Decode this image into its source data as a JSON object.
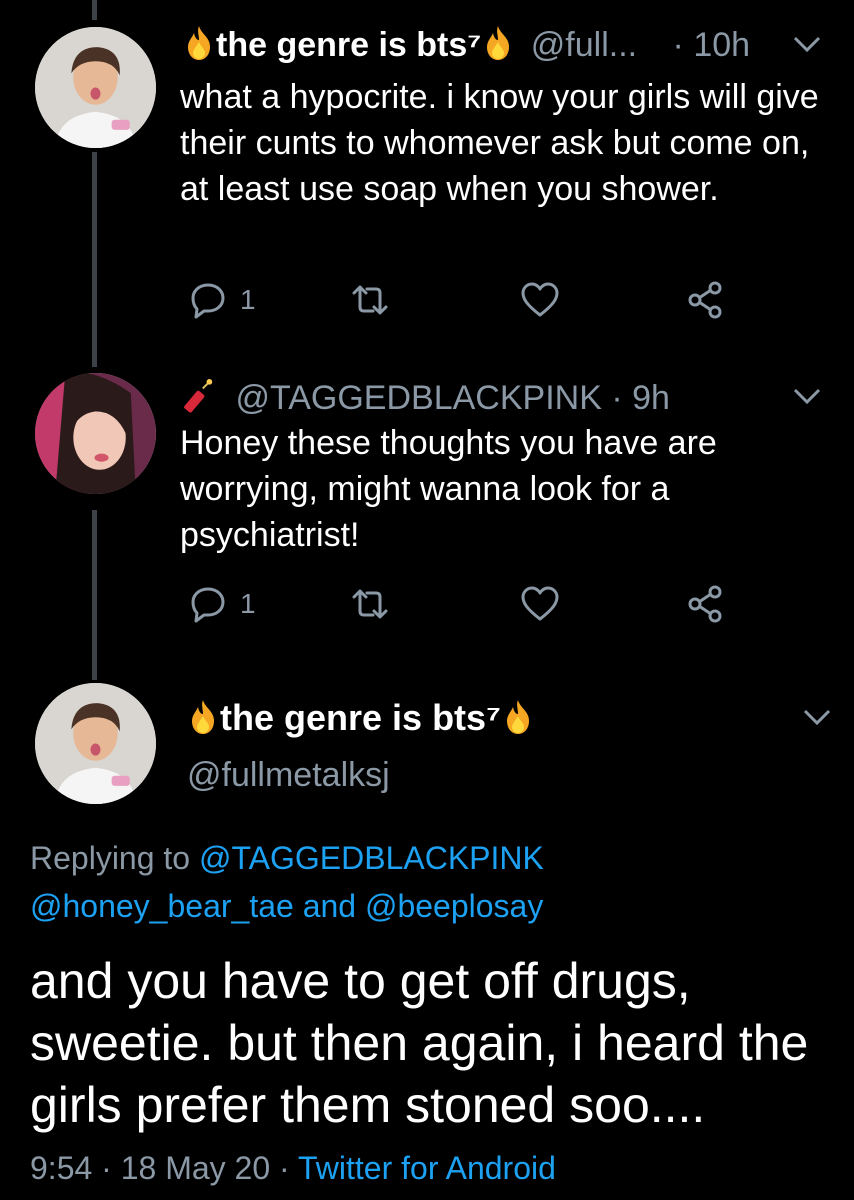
{
  "tweet1": {
    "display_name": "the genre is bts⁷",
    "handle": "@full...",
    "time": "· 10h",
    "text": "what a hypocrite. i know your girls will give their cunts to whomever ask but come on, at least use soap when you shower.",
    "reply_count": "1"
  },
  "tweet2": {
    "handle": "@TAGGEDBLACKPINK",
    "time": "· 9h",
    "text": "Honey these thoughts you have are worrying, might wanna look for a psychiatrist!",
    "reply_count": "1"
  },
  "main_tweet": {
    "display_name": "the genre is bts⁷",
    "handle": "@fullmetalksj",
    "replying_prefix": "Replying to",
    "reply_to_1": "@TAGGEDBLACKPINK",
    "reply_to_2": "@honey_bear_tae",
    "reply_and": "and",
    "reply_to_3": "@beeplosay",
    "text": "and you have to get off drugs, sweetie. but then again, i heard the girls prefer them stoned soo....",
    "time": "9:54",
    "sep1": "·",
    "date": "18 May 20",
    "sep2": "·",
    "source": "Twitter for Android"
  },
  "icons": {
    "fire": "fire-emoji",
    "firecracker": "firecracker-emoji",
    "reply": "reply-icon",
    "retweet": "retweet-icon",
    "like": "heart-icon",
    "share": "share-icon",
    "chevron": "chevron-down-icon"
  },
  "colors": {
    "background": "#000000",
    "secondary_text": "#8b98a5",
    "link": "#1da1f2",
    "thread_line": "#3d4248"
  }
}
